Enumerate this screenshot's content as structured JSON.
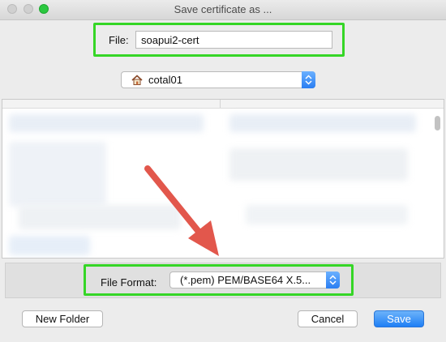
{
  "window": {
    "title": "Save certificate as ..."
  },
  "file": {
    "label": "File:",
    "value": "soapui2-cert"
  },
  "location": {
    "selected": "cotal01",
    "icon": "home-icon"
  },
  "format": {
    "label": "File Format:",
    "selected": "(*.pem) PEM/BASE64 X.5..."
  },
  "buttons": {
    "new_folder": "New Folder",
    "cancel": "Cancel",
    "save": "Save"
  },
  "colors": {
    "highlight": "#35d626",
    "arrow": "#e2574c",
    "primary": "#1f7ff5"
  }
}
